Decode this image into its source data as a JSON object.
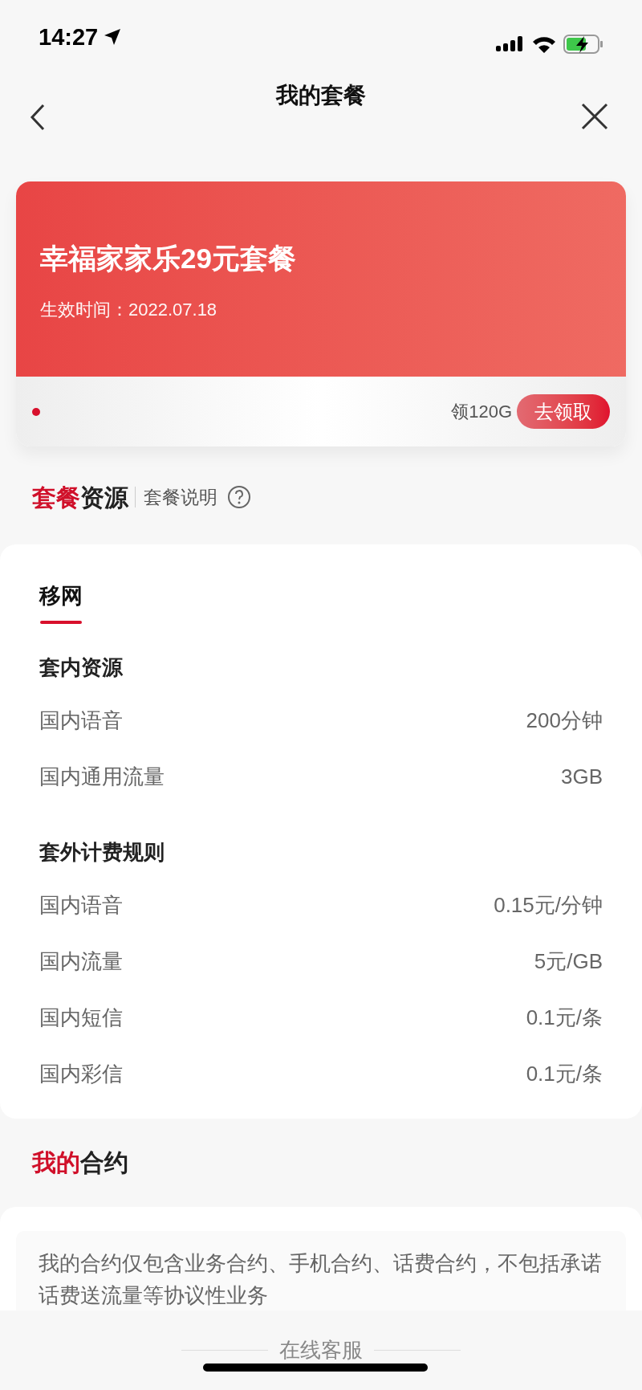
{
  "status_bar": {
    "time": "14:27"
  },
  "header": {
    "title": "我的套餐"
  },
  "plan_card": {
    "name": "幸福家家乐29元套餐",
    "effective_date": "生效时间：2022.07.18",
    "promo_text": "领120G",
    "promo_button": "去领取"
  },
  "resources_heading": {
    "highlight": "套餐",
    "rest": "资源",
    "link": "套餐说明"
  },
  "resource_tabs": [
    {
      "label": "移网",
      "selected": true
    }
  ],
  "groups": [
    {
      "title": "套内资源",
      "rows": [
        {
          "label": "国内语音",
          "value": "200分钟"
        },
        {
          "label": "国内通用流量",
          "value": "3GB"
        }
      ]
    },
    {
      "title": "套外计费规则",
      "rows": [
        {
          "label": "国内语音",
          "value": "0.15元/分钟"
        },
        {
          "label": "国内流量",
          "value": "5元/GB"
        },
        {
          "label": "国内短信",
          "value": "0.1元/条"
        },
        {
          "label": "国内彩信",
          "value": "0.1元/条"
        }
      ]
    }
  ],
  "contract_heading": {
    "highlight": "我的",
    "rest": "合约"
  },
  "contract_note": "我的合约仅包含业务合约、手机合约、话费合约，不包括承诺话费送流量等协议性业务",
  "bottom_bar": {
    "label": "在线客服"
  }
}
